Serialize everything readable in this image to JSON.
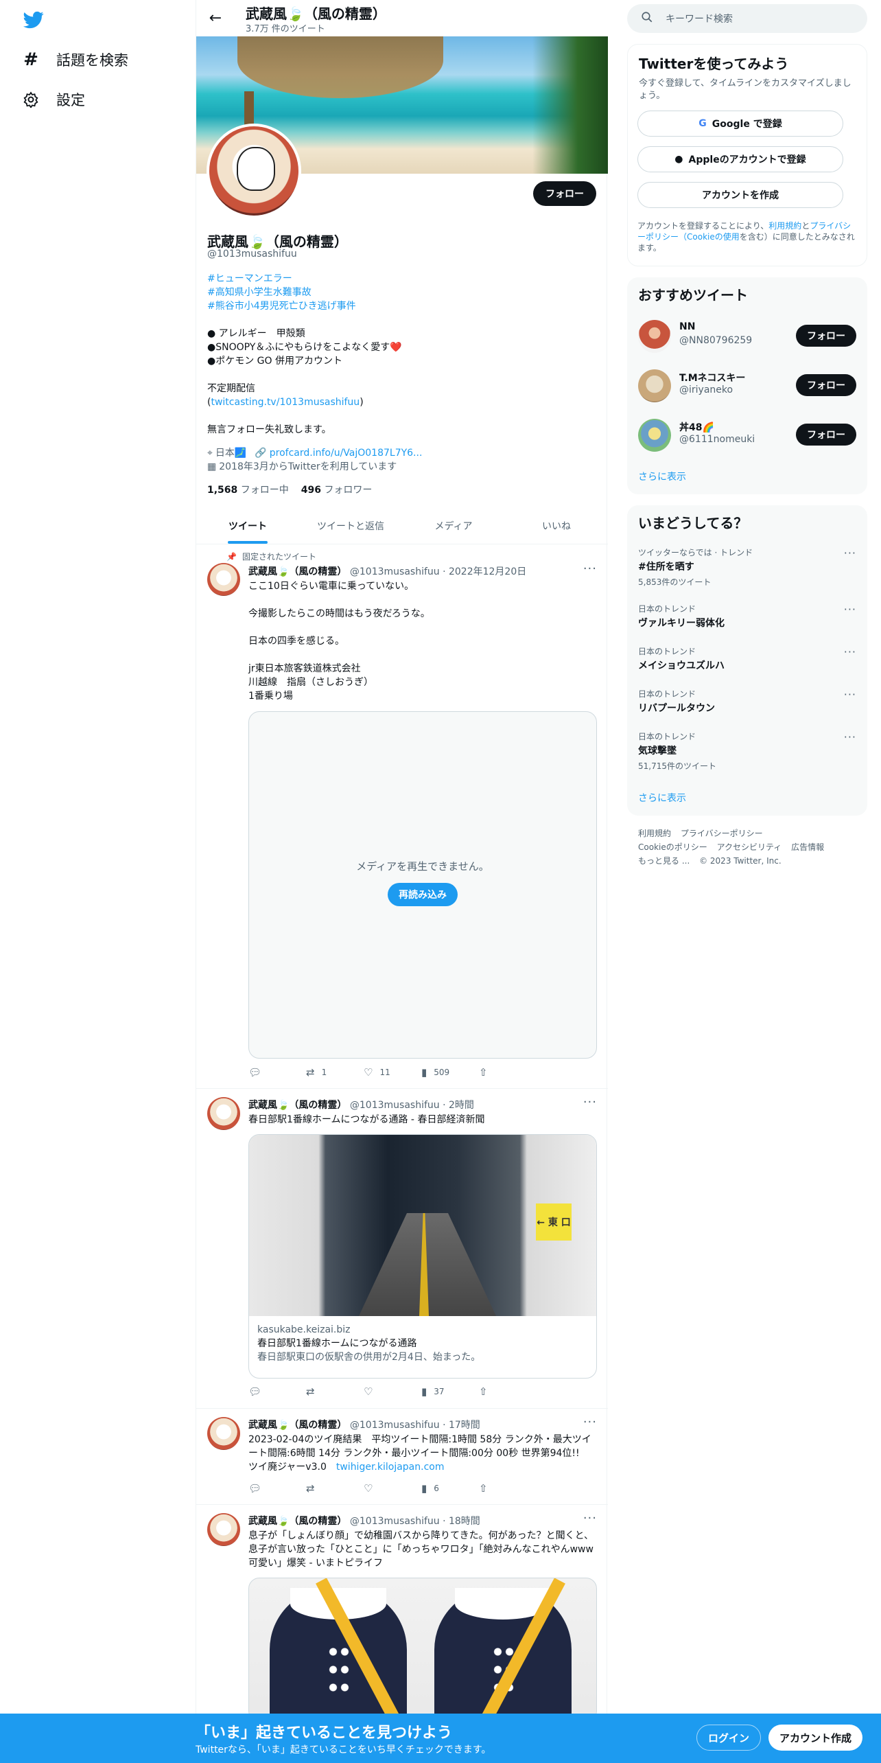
{
  "nav": {
    "logo_icon": "twitter-bird-icon",
    "items": [
      {
        "label": "話題を検索",
        "icon": "hash-icon"
      },
      {
        "label": "設定",
        "icon": "gear-icon"
      }
    ]
  },
  "topbar": {
    "name": "武蔵風🍃（風の精霊）",
    "tweet_count": "3.7万 件のツイート"
  },
  "profile": {
    "name": "武蔵風🍃（風の精霊）",
    "handle": "@1013musashifuu",
    "follow_label": "フォロー",
    "hashtags": [
      "#ヒューマンエラー",
      "#高知県小学生水難事故",
      "#熊谷市小4男児死亡ひき逃げ事件"
    ],
    "bio_lines": [
      "● アレルギー　甲殻類",
      "●SNOOPY＆ふにやもらけをこよなく愛す❤️",
      "●ポケモン GO 併用アカウント"
    ],
    "stream_label": "不定期配信",
    "stream_link": "twitcasting.tv/1013musashifuu",
    "no_mention": "無言フォロー失礼致します。",
    "location": "日本🗾",
    "website": "profcard.info/u/VajO0187L7Y6...",
    "joined": "2018年3月からTwitterを利用しています",
    "following_count": "1,568",
    "following_label": "フォロー中",
    "followers_count": "496",
    "followers_label": "フォロワー"
  },
  "tabs": [
    "ツイート",
    "ツイートと返信",
    "メディア",
    "いいね"
  ],
  "tweets": [
    {
      "pinned": "固定されたツイート",
      "name": "武蔵風🍃（風の精霊）",
      "meta": "@1013musashifuu · 2022年12月20日",
      "lines": [
        "ここ10日ぐらい電車に乗っていない。",
        "",
        "今撮影したらこの時間はもう夜だろうな。",
        "",
        "日本の四季を感じる。",
        "",
        "jr東日本旅客鉄道株式会社",
        "川越線　指扇（さしおうぎ）",
        "1番乗り場"
      ],
      "media_error": "メディアを再生できません。",
      "reload_label": "再読み込み",
      "replies": "",
      "retweets": "1",
      "likes": "11",
      "views": "509"
    },
    {
      "name": "武蔵風🍃（風の精霊）",
      "meta": "@1013musashifuu · 2時間",
      "text": "春日部駅1番線ホームにつながる通路 - 春日部経済新聞",
      "card_sign": "← 東 口",
      "card_domain": "kasukabe.keizai.biz",
      "card_title": "春日部駅1番線ホームにつながる通路",
      "card_desc": "春日部駅東口の仮駅舎の供用が2月4日、始まった。",
      "replies": "",
      "retweets": "",
      "likes": "",
      "views": "37"
    },
    {
      "name": "武蔵風🍃（風の精霊）",
      "meta": "@1013musashifuu · 17時間",
      "text": "2023-02-04のツイ廃結果　平均ツイート間隔:1時間 58分 ランク外・最大ツイート間隔:6時間 14分 ランク外・最小ツイート間隔:00分 00秒 世界第94位!!　ツイ廃ジャーv3.0",
      "link": "twihiger.kilojapan.com",
      "replies": "",
      "retweets": "",
      "likes": "",
      "views": "6"
    },
    {
      "name": "武蔵風🍃（風の精霊）",
      "meta": "@1013musashifuu · 18時間",
      "text": "息子が「しょんぼり顔」で幼稚園バスから降りてきた。何があった？と聞くと、息子が言い放った「ひとこと」に「めっちゃワロタ」「絶対みんなこれやんwww可愛い」爆笑 - いまトピライフ"
    }
  ],
  "sidebar": {
    "search_placeholder": "キーワード検索",
    "signup": {
      "title": "Twitterを使ってみよう",
      "subtitle": "今すぐ登録して、タイムラインをカスタマイズしましょう。",
      "google": "Google で登録",
      "apple": "Appleのアカウントで登録",
      "create": "アカウントを作成",
      "legal_prefix": "アカウントを登録することにより、",
      "legal_terms": "利用規約",
      "legal_and": "と",
      "legal_privacy": "プライバシーポリシー（Cookieの使用",
      "legal_suffix": "を含む）に同意したとみなされます。"
    },
    "recommend": {
      "title": "おすすめツイート",
      "users": [
        {
          "name": "NN",
          "handle": "@NN80796259",
          "follow": "フォロー",
          "color": "#c8553d"
        },
        {
          "name": "T.Mネコスキー",
          "handle": "@iriyaneko",
          "follow": "フォロー",
          "color": "#c9a77a"
        },
        {
          "name": "丼48🌈",
          "handle": "@6111nomeuki",
          "follow": "フォロー",
          "color": "#6aa0c8"
        }
      ],
      "more": "さらに表示"
    },
    "trends": {
      "title": "いまどうしてる？",
      "items": [
        {
          "context": "ツイッターならでは · トレンド",
          "title": "#住所を晒す",
          "count": "5,853件のツイート"
        },
        {
          "context": "日本のトレンド",
          "title": "ヴァルキリー弱体化",
          "count": ""
        },
        {
          "context": "日本のトレンド",
          "title": "メイショウユズルハ",
          "count": ""
        },
        {
          "context": "日本のトレンド",
          "title": "リバプールタウン",
          "count": ""
        },
        {
          "context": "日本のトレンド",
          "title": "気球撃墜",
          "count": "51,715件のツイート"
        }
      ],
      "more": "さらに表示"
    },
    "footer": {
      "row1": [
        "利用規約",
        "プライバシーポリシー"
      ],
      "row2": [
        "Cookieのポリシー",
        "アクセシビリティ",
        "広告情報"
      ],
      "more": "もっと見る ...",
      "copyright": "© 2023 Twitter, Inc."
    }
  },
  "bottombar": {
    "title": "「いま」起きていることを見つけよう",
    "subtitle": "Twitterなら、「いま」起きていることをいち早くチェックできます。",
    "login": "ログイン",
    "signup": "アカウント作成"
  },
  "colors": {
    "accent": "#1d9bf0",
    "text": "#0f1419",
    "muted": "#536471"
  }
}
